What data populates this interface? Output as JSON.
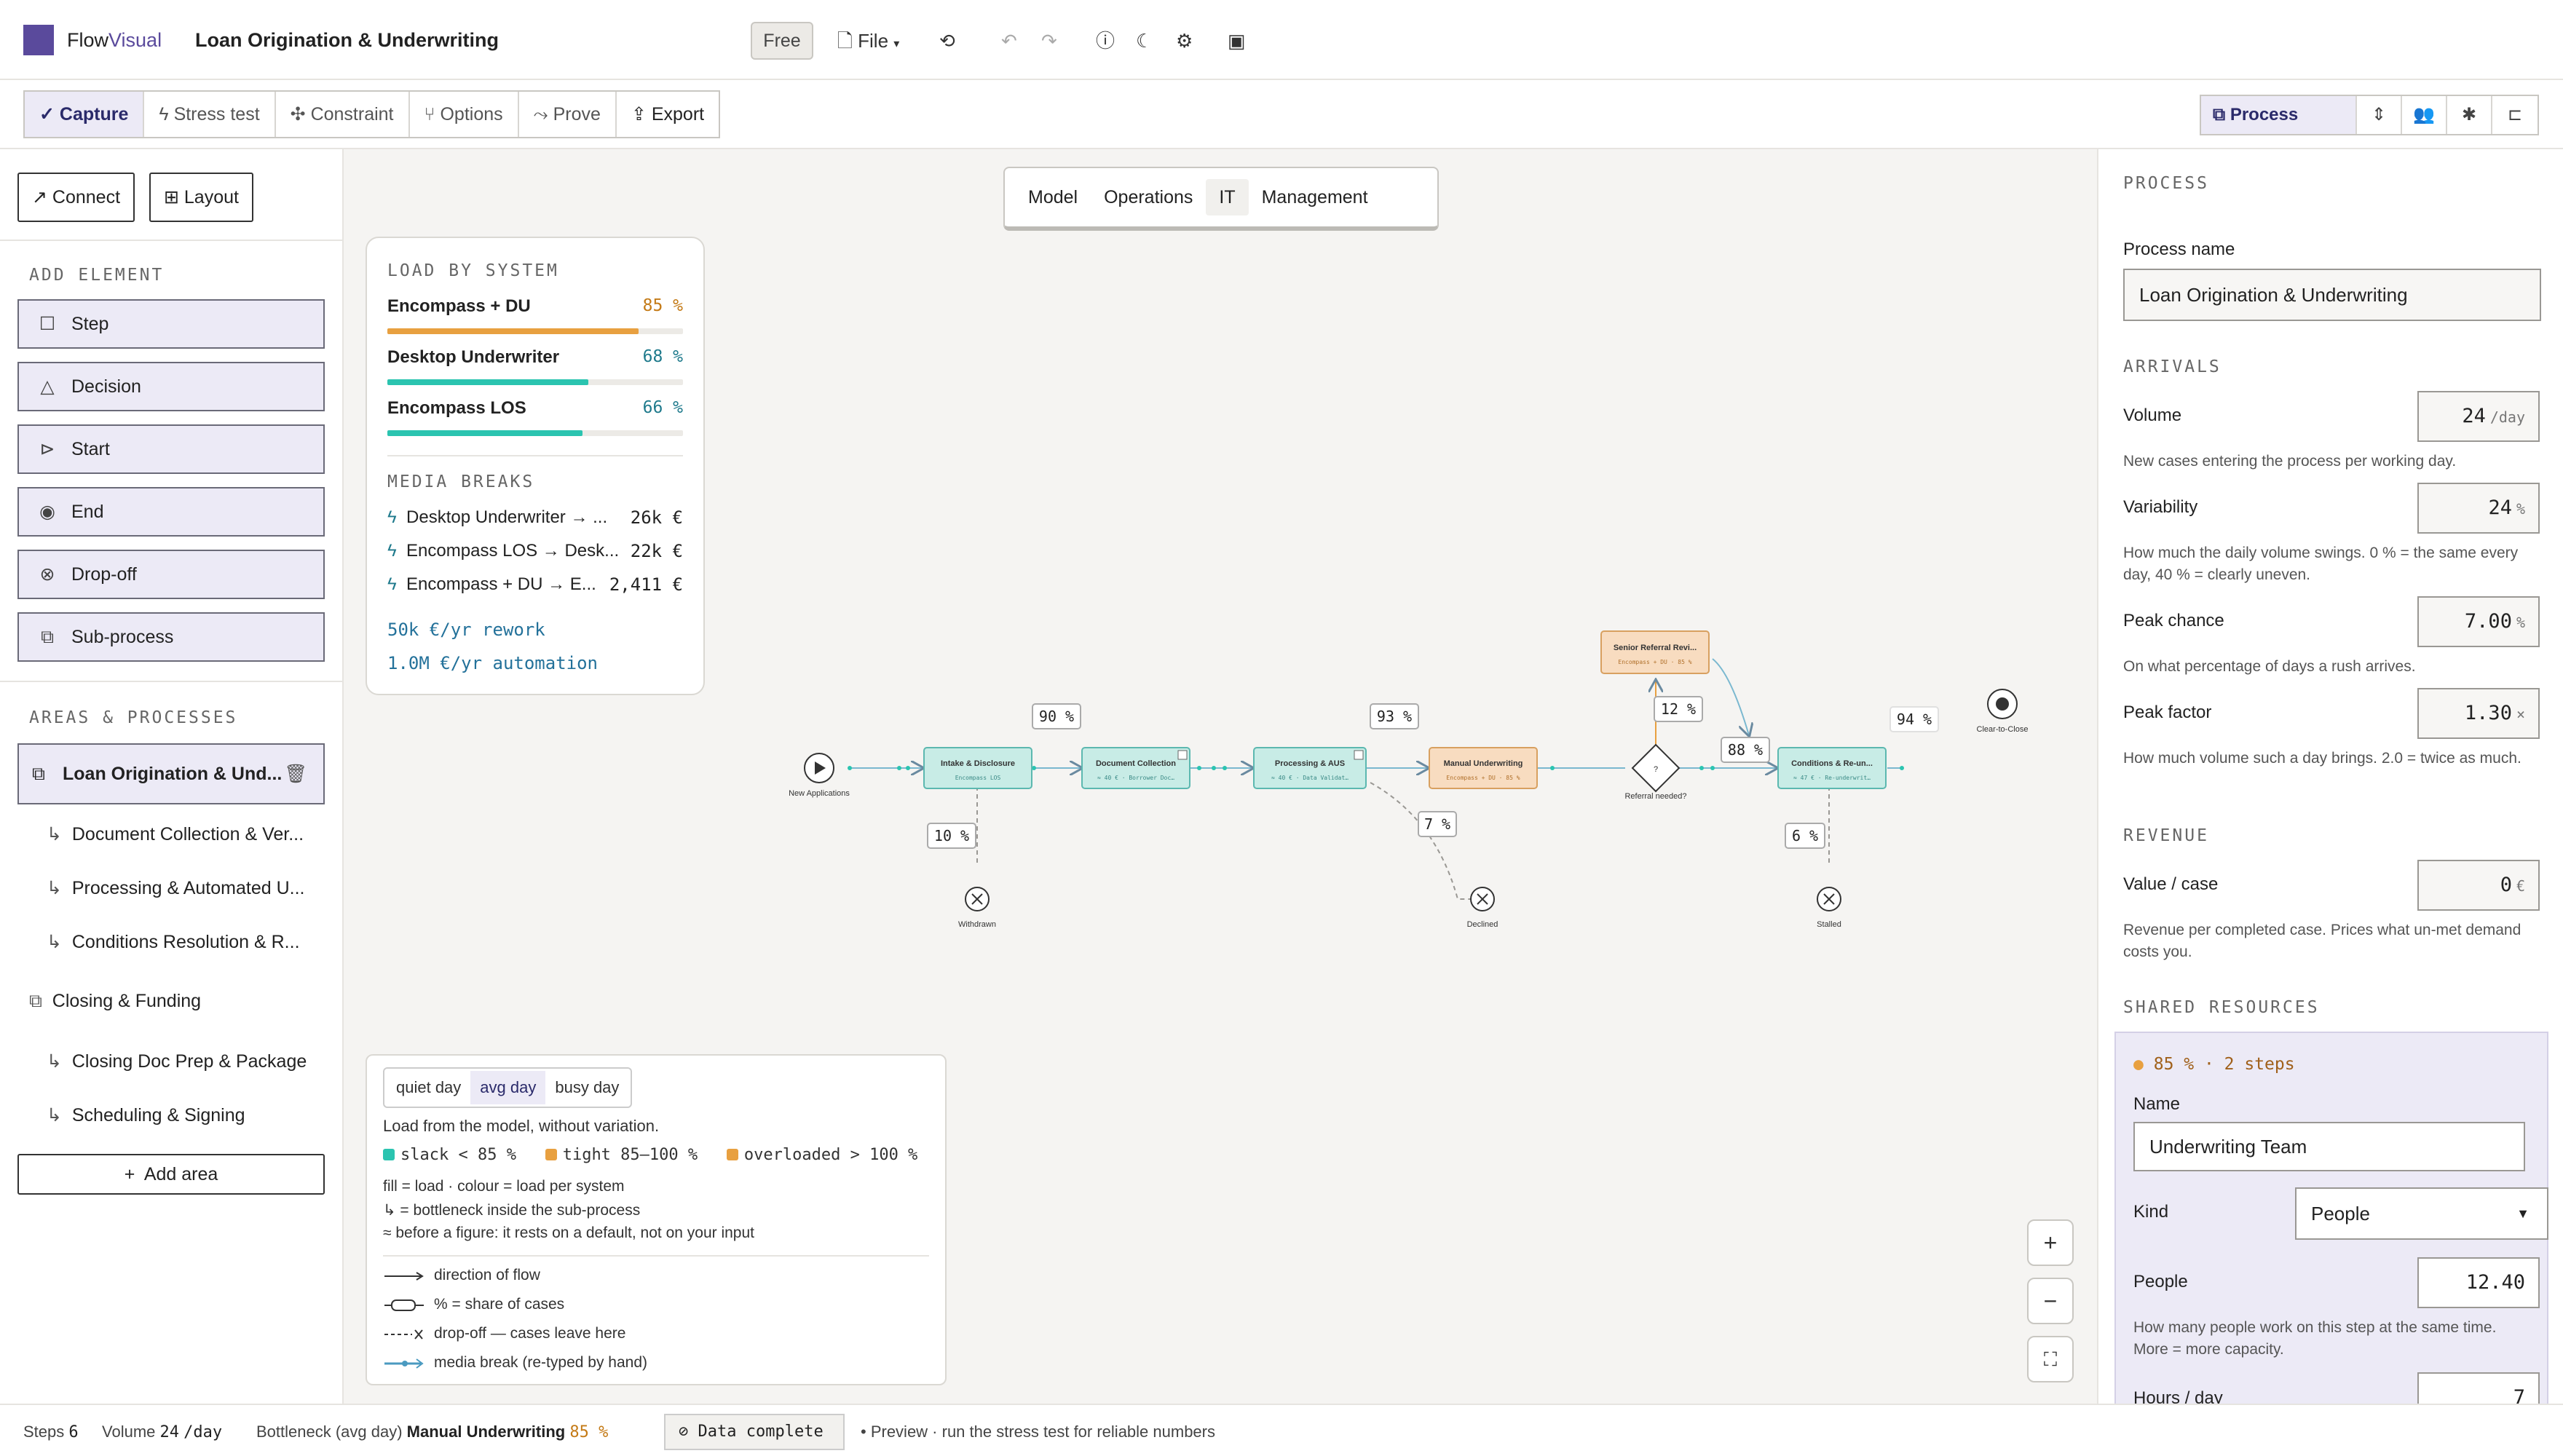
{
  "header": {
    "brand_prefix": "Flow",
    "brand_suffix": "Visual",
    "title": "Loan Origination & Underwriting",
    "plan_badge": "Free",
    "file_menu": "File"
  },
  "toolbar": {
    "modes": [
      "Capture",
      "Stress test",
      "Constraint",
      "Options",
      "Prove",
      "Export"
    ],
    "view_selected": "Process"
  },
  "sidebar": {
    "connect": "Connect",
    "layout": "Layout",
    "add_element_caption": "ADD ELEMENT",
    "elements": [
      "Step",
      "Decision",
      "Start",
      "End",
      "Drop-off",
      "Sub-process"
    ],
    "areas_caption": "AREAS & PROCESSES",
    "areas": {
      "selected": "Loan Origination & Und...",
      "sub1": "Document Collection & Ver...",
      "sub2": "Processing & Automated U...",
      "sub3": "Conditions Resolution & R...",
      "area2": "Closing & Funding",
      "sub4": "Closing Doc Prep & Package",
      "sub5": "Scheduling & Signing"
    },
    "add_area": "Add area"
  },
  "canvas": {
    "tabs": [
      "Model",
      "Operations",
      "IT",
      "Management"
    ],
    "active_tab": "IT",
    "load_card": {
      "caption": "LOAD BY SYSTEM",
      "systems": [
        {
          "name": "Encompass + DU",
          "pct": "85 %",
          "value": 0.85,
          "color": "#e8a040"
        },
        {
          "name": "Desktop Underwriter",
          "pct": "68 %",
          "value": 0.68,
          "color": "#2bc4b0"
        },
        {
          "name": "Encompass LOS",
          "pct": "66 %",
          "value": 0.66,
          "color": "#2bc4b0"
        }
      ],
      "breaks_caption": "MEDIA BREAKS",
      "breaks": [
        {
          "name": "Desktop Underwriter → ...",
          "value": "26k €"
        },
        {
          "name": "Encompass LOS → Desk...",
          "value": "22k €"
        },
        {
          "name": "Encompass + DU → E...",
          "value": "2,411 €"
        }
      ],
      "rework": "50k €/yr rework",
      "automation": "1.0M €/yr automation"
    },
    "diagram": {
      "start": "New Applications",
      "end": "Clear-to-Close",
      "steps": [
        {
          "name": "Intake & Disclosure",
          "sub": "Encompass LOS"
        },
        {
          "name": "Document Collection",
          "sub": "≈ 40 € · Borrower Doc…"
        },
        {
          "name": "Processing & AUS",
          "sub": "≈ 40 € · Data Validat…"
        },
        {
          "name": "Manual Underwriting",
          "sub": "Encompass + DU · 85 %"
        },
        {
          "name": "Senior Referral Revi...",
          "sub": "Encompass + DU · 85 %"
        },
        {
          "name": "Conditions & Re-un...",
          "sub": "≈ 47 € · Re-underwrit…"
        }
      ],
      "decision": "Referral needed?",
      "dropoffs": [
        "Withdrawn",
        "Declined",
        "Stalled"
      ],
      "pcts": [
        "90 %",
        "93 %",
        "10 %",
        "7 %",
        "12 %",
        "88 %",
        "94 %",
        "6 %"
      ],
      "decision_glyph": "?"
    },
    "legend": {
      "modes": [
        "quiet day",
        "avg day",
        "busy day"
      ],
      "active_mode": "avg day",
      "note": "Load from the model, without variation.",
      "slack": "slack < 85 %",
      "tight": "tight 85–100 %",
      "over": "overloaded > 100 %",
      "lines": [
        "fill = load · colour = load per system",
        "↳ = bottleneck inside the sub-process",
        "≈ before a figure: it rests on a default, not on your input"
      ],
      "flow": "direction of flow",
      "share": "% = share of cases",
      "drop": "drop-off — cases leave here",
      "media": "media break (re-typed by hand)"
    }
  },
  "panel": {
    "caption": "PROCESS",
    "name_label": "Process name",
    "name_value": "Loan Origination & Underwriting",
    "arrivals_caption": "ARRIVALS",
    "volume_label": "Volume",
    "volume_value": "24",
    "volume_unit": "/day",
    "volume_help": "New cases entering the process per working day.",
    "variability_label": "Variability",
    "variability_value": "24",
    "variability_unit": "%",
    "variability_help": "How much the daily volume swings. 0 % = the same every day, 40 % = clearly uneven.",
    "peak_chance_label": "Peak chance",
    "peak_chance_value": "7.00",
    "peak_chance_unit": "%",
    "peak_chance_help": "On what percentage of days a rush arrives.",
    "peak_factor_label": "Peak factor",
    "peak_factor_value": "1.30",
    "peak_factor_unit": "×",
    "peak_factor_help": "How much volume such a day brings. 2.0 = twice as much.",
    "revenue_caption": "REVENUE",
    "value_label": "Value / case",
    "value_value": "0",
    "value_unit": "€",
    "value_help": "Revenue per completed case. Prices what un-met demand costs you.",
    "shared_caption": "SHARED RESOURCES",
    "resource": {
      "summary": "85 % · 2 steps",
      "name_label": "Name",
      "name_value": "Underwriting Team",
      "kind_label": "Kind",
      "kind_value": "People",
      "people_label": "People",
      "people_value": "12.40",
      "people_help": "How many people work on this step at the same time. More = more capacity.",
      "hours_label": "Hours / day",
      "hours_value": "7"
    }
  },
  "status": {
    "steps_label": "Steps",
    "steps_value": "6",
    "volume_label": "Volume",
    "volume_value": "24",
    "volume_unit": "/day",
    "bottleneck_label": "Bottleneck (avg day)",
    "bottleneck_value": "Manual Underwriting",
    "bottleneck_pct": "85 %",
    "data_complete": "Data complete",
    "preview": "• Preview · run the stress test for reliable numbers"
  },
  "colors": {
    "brand": "#5a4a9c",
    "slack": "#2bc4b0",
    "tight": "#e8a040",
    "link": "#23719a"
  }
}
